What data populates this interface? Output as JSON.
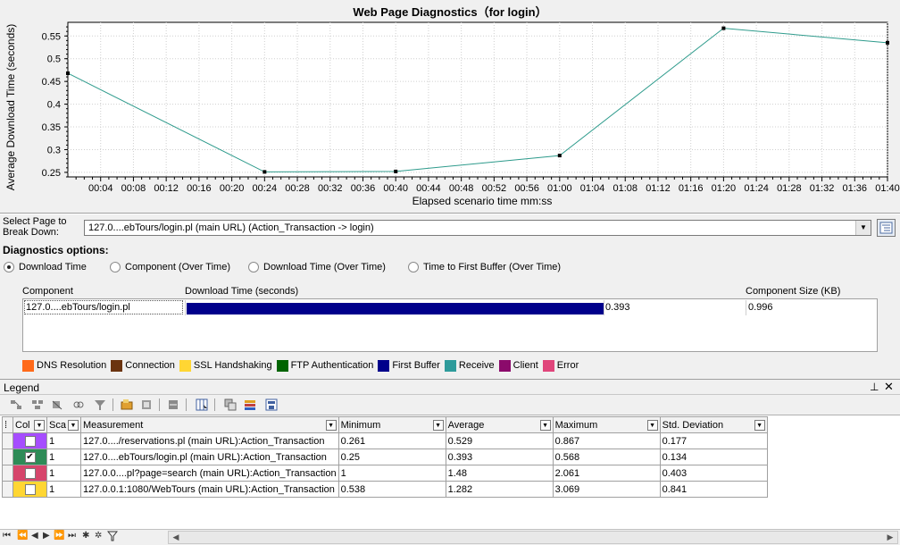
{
  "chart": {
    "title": "Web Page Diagnostics（for login）",
    "ylabel": "Average Download Time (seconds)",
    "xlabel": "Elapsed scenario time mm:ss"
  },
  "chart_data": {
    "type": "line",
    "title": "Web Page Diagnostics（for login）",
    "xlabel": "Elapsed scenario time mm:ss",
    "ylabel": "Average Download Time (seconds)",
    "x_unit": "seconds",
    "xlim": [
      0,
      100
    ],
    "ylim": [
      0.24,
      0.58
    ],
    "yticks": [
      0.25,
      0.3,
      0.35,
      0.4,
      0.45,
      0.5,
      0.55
    ],
    "xticks": [
      "00:04",
      "00:08",
      "00:12",
      "00:16",
      "00:20",
      "00:24",
      "00:28",
      "00:32",
      "00:36",
      "00:40",
      "00:44",
      "00:48",
      "00:52",
      "00:56",
      "01:00",
      "01:04",
      "01:08",
      "01:12",
      "01:16",
      "01:20",
      "01:24",
      "01:28",
      "01:32",
      "01:36",
      "01:40"
    ],
    "grid": true,
    "series": [
      {
        "color": "#2e9b8c",
        "x": [
          "00:00",
          "00:24",
          "00:40",
          "01:00",
          "01:20",
          "01:40"
        ],
        "x_seconds": [
          0,
          24,
          40,
          60,
          80,
          100
        ],
        "y": [
          0.468,
          0.251,
          0.252,
          0.287,
          0.567,
          0.535
        ]
      }
    ]
  },
  "select_page": {
    "label": "Select Page to Break Down:",
    "value": "127.0....ebTours/login.pl (main URL) (Action_Transaction -> login)"
  },
  "diagnostics": {
    "title": "Diagnostics options:",
    "options": [
      {
        "label": "Download Time",
        "selected": true
      },
      {
        "label": "Component (Over Time)",
        "selected": false
      },
      {
        "label": "Download Time (Over Time)",
        "selected": false
      },
      {
        "label": "Time to First Buffer (Over Time)",
        "selected": false
      }
    ]
  },
  "breakdown": {
    "headers": {
      "component": "Component",
      "download_time": "Download Time (seconds)",
      "size": "Component Size (KB)"
    },
    "rows": [
      {
        "component": "127.0....ebTours/login.pl",
        "download_time": "0.393",
        "size": "0.996",
        "bar_fraction": 0.62
      }
    ]
  },
  "color_legend": [
    {
      "label": "DNS Resolution",
      "color": "#ff6a1a"
    },
    {
      "label": "Connection",
      "color": "#6b3410"
    },
    {
      "label": "SSL Handshaking",
      "color": "#ffd633"
    },
    {
      "label": "FTP Authentication",
      "color": "#006400"
    },
    {
      "label": "First Buffer",
      "color": "#00008b"
    },
    {
      "label": "Receive",
      "color": "#2e9b9b"
    },
    {
      "label": "Client",
      "color": "#8b0a6b"
    },
    {
      "label": "Error",
      "color": "#e0457b"
    }
  ],
  "legend": {
    "title": "Legend",
    "columns": [
      "Col",
      "Sca",
      "Measurement",
      "Minimum",
      "Average",
      "Maximum",
      "Std. Deviation"
    ],
    "rows": [
      {
        "color": "#a64dff",
        "checked": false,
        "scale": "1",
        "measurement": "127.0..../reservations.pl (main URL):Action_Transaction",
        "min": "0.261",
        "avg": "0.529",
        "max": "0.867",
        "std": "0.177"
      },
      {
        "color": "#2e8b57",
        "checked": true,
        "scale": "1",
        "measurement": "127.0....ebTours/login.pl (main URL):Action_Transaction",
        "min": "0.25",
        "avg": "0.393",
        "max": "0.568",
        "std": "0.134"
      },
      {
        "color": "#d6456b",
        "checked": false,
        "scale": "1",
        "measurement": "127.0.0....pl?page=search (main URL):Action_Transaction",
        "min": "1",
        "avg": "1.48",
        "max": "2.061",
        "std": "0.403"
      },
      {
        "color": "#ffd633",
        "checked": false,
        "scale": "1",
        "measurement": "127.0.0.1:1080/WebTours (main URL):Action_Transaction",
        "min": "0.538",
        "avg": "1.282",
        "max": "3.069",
        "std": "0.841"
      }
    ]
  },
  "icons": {
    "pin": "pin-icon",
    "close": "close-icon"
  }
}
